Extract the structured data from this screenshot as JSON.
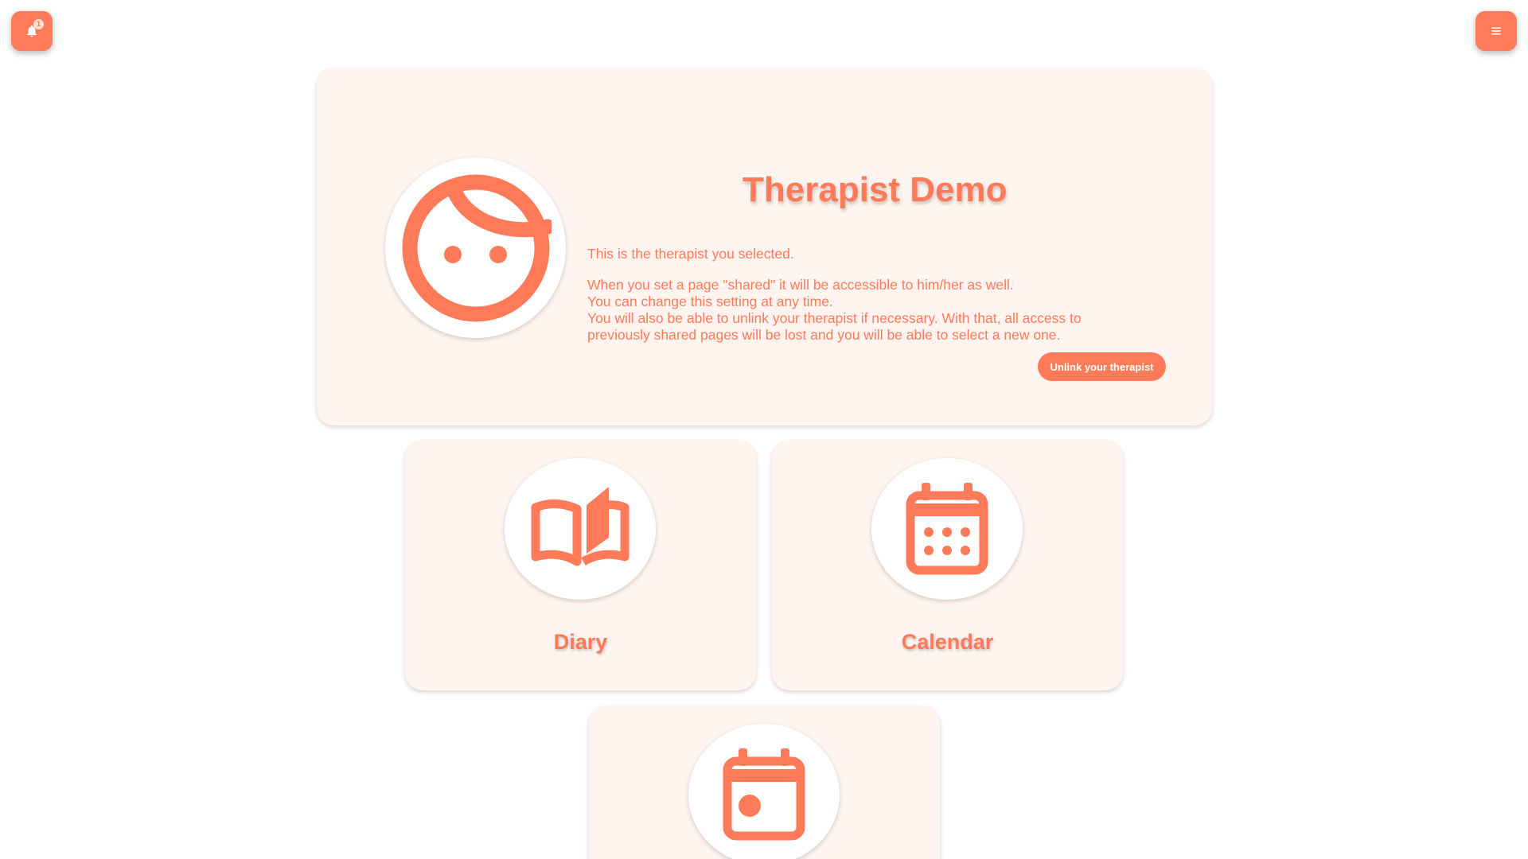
{
  "notifications": {
    "count": "1",
    "icon": "bell-icon"
  },
  "menu": {
    "icon": "hamburger-menu-icon"
  },
  "therapist": {
    "name": "Therapist Demo",
    "avatar_icon": "face-icon",
    "description_line1": "This is the therapist you selected.",
    "description_line2": "When you set a page \"shared\" it will be accessible to him/her as well.",
    "description_line3": "You can change this setting at any time.",
    "description_line4": "You will also be able to unlink your therapist if necessary. With that, all access to previously shared pages will be lost and you will be able to select a new one.",
    "unlink_button": "Unlink your therapist"
  },
  "tiles": [
    {
      "label": "Diary",
      "icon": "open-book-icon"
    },
    {
      "label": "Calendar",
      "icon": "calendar-icon"
    },
    {
      "label": "",
      "icon": "event-icon"
    }
  ],
  "colors": {
    "accent": "#ff7a59",
    "card_background": "#fff4ef",
    "page_background": "#ffffff"
  }
}
